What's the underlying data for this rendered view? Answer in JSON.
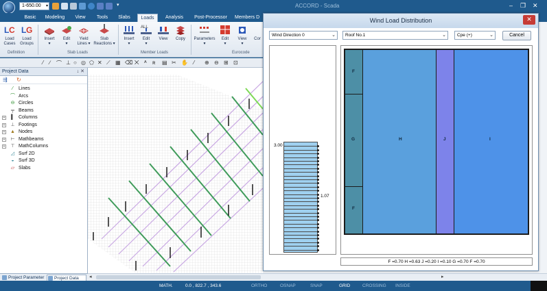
{
  "app": {
    "title": "ACCORD - Scada",
    "level_value": "1-650.00",
    "win_controls": [
      "–",
      "❐",
      "✕"
    ]
  },
  "tabs": [
    {
      "label": "Basic",
      "active": false
    },
    {
      "label": "Modeling",
      "active": false
    },
    {
      "label": "View",
      "active": false
    },
    {
      "label": "Tools",
      "active": false
    },
    {
      "label": "Slabs",
      "active": false
    },
    {
      "label": "Loads",
      "active": true
    },
    {
      "label": "Analysis",
      "active": false
    },
    {
      "label": "Post-Processor",
      "active": false
    },
    {
      "label": "Members D",
      "active": false
    }
  ],
  "ribbon": {
    "buttons": [
      {
        "label": "Load\nCases",
        "icon": "load-cases-icon"
      },
      {
        "label": "Load\nGroups",
        "icon": "load-groups-icon"
      },
      {
        "label": "Insert\n▾",
        "icon": "slab-insert-icon"
      },
      {
        "label": "Edit\n▾",
        "icon": "slab-edit-icon"
      },
      {
        "label": "Yield\nLines ▾",
        "icon": "yield-lines-icon"
      },
      {
        "label": "Slab\nReactions ▾",
        "icon": "slab-reactions-icon"
      },
      {
        "label": "Insert\n▾",
        "icon": "member-insert-icon"
      },
      {
        "label": "Edit\n▾",
        "icon": "member-edit-icon"
      },
      {
        "label": "View",
        "icon": "member-view-icon"
      },
      {
        "label": "Copy",
        "icon": "member-copy-icon"
      },
      {
        "label": "Parameters\n▾",
        "icon": "parameters-icon"
      },
      {
        "label": "Edit\n▾",
        "icon": "eurocode-edit-icon"
      },
      {
        "label": "View\n▾",
        "icon": "eurocode-view-icon"
      },
      {
        "label": "Cor",
        "icon": "cor-icon"
      }
    ],
    "groups": [
      "Definition",
      "Slab Loads",
      "Member Loads",
      "Eurocode"
    ]
  },
  "project_panel": {
    "title": "Project Data",
    "pin": "↓ ✕",
    "items": [
      {
        "label": "Lines",
        "icon": "lines-icon",
        "expandable": false
      },
      {
        "label": "Arcs",
        "icon": "arcs-icon",
        "expandable": false
      },
      {
        "label": "Circles",
        "icon": "circles-icon",
        "expandable": false
      },
      {
        "label": "Beams",
        "icon": "beams-icon",
        "expandable": false
      },
      {
        "label": "Columns",
        "icon": "columns-icon",
        "expandable": true
      },
      {
        "label": "Footings",
        "icon": "footings-icon",
        "expandable": true
      },
      {
        "label": "Nodes",
        "icon": "nodes-icon",
        "expandable": true
      },
      {
        "label": "Mathbeams",
        "icon": "mathbeams-icon",
        "expandable": true
      },
      {
        "label": "MathColumns",
        "icon": "mathcolumns-icon",
        "expandable": true
      },
      {
        "label": "Surf 2D",
        "icon": "surf2d-icon",
        "expandable": false
      },
      {
        "label": "Surf 3D",
        "icon": "surf3d-icon",
        "expandable": false
      },
      {
        "label": "Slabs",
        "icon": "slabs-icon",
        "expandable": false
      }
    ],
    "bottom_tabs": [
      {
        "label": "Project Parameter",
        "active": false
      },
      {
        "label": "Project Data",
        "active": true
      }
    ]
  },
  "dialog": {
    "title": "Wind Load Distribution",
    "close": "✕",
    "wind_direction": "Wind Direction 0",
    "roof": "Roof No.1",
    "cpe": "Cpe (+)",
    "cancel_label": "Cancel",
    "diagram": {
      "value_top": "3.00",
      "value_mid": "1.07",
      "zones": [
        {
          "label": "F",
          "color": "#4d8fa6"
        },
        {
          "label": "G",
          "color": "#4d8fa6"
        },
        {
          "label": "F",
          "color": "#4d8fa6"
        },
        {
          "label": "H",
          "color": "#5aa0dd"
        },
        {
          "label": "J",
          "color": "#7d83ea"
        },
        {
          "label": "I",
          "color": "#4e92e8"
        }
      ]
    },
    "formula": "F =0.70 H =0.63 J =0.20 I =0.10 G =0.70 F =0.70"
  },
  "statusbar": {
    "math": "MATH.",
    "coords": "0.0 , 822.7 , 343.6",
    "ortho": "ORTHO",
    "osnap": "OSNAP",
    "snap": "SNAP",
    "grid": "GRID",
    "crossing": "CROSSING",
    "inside": "INSIDE"
  }
}
